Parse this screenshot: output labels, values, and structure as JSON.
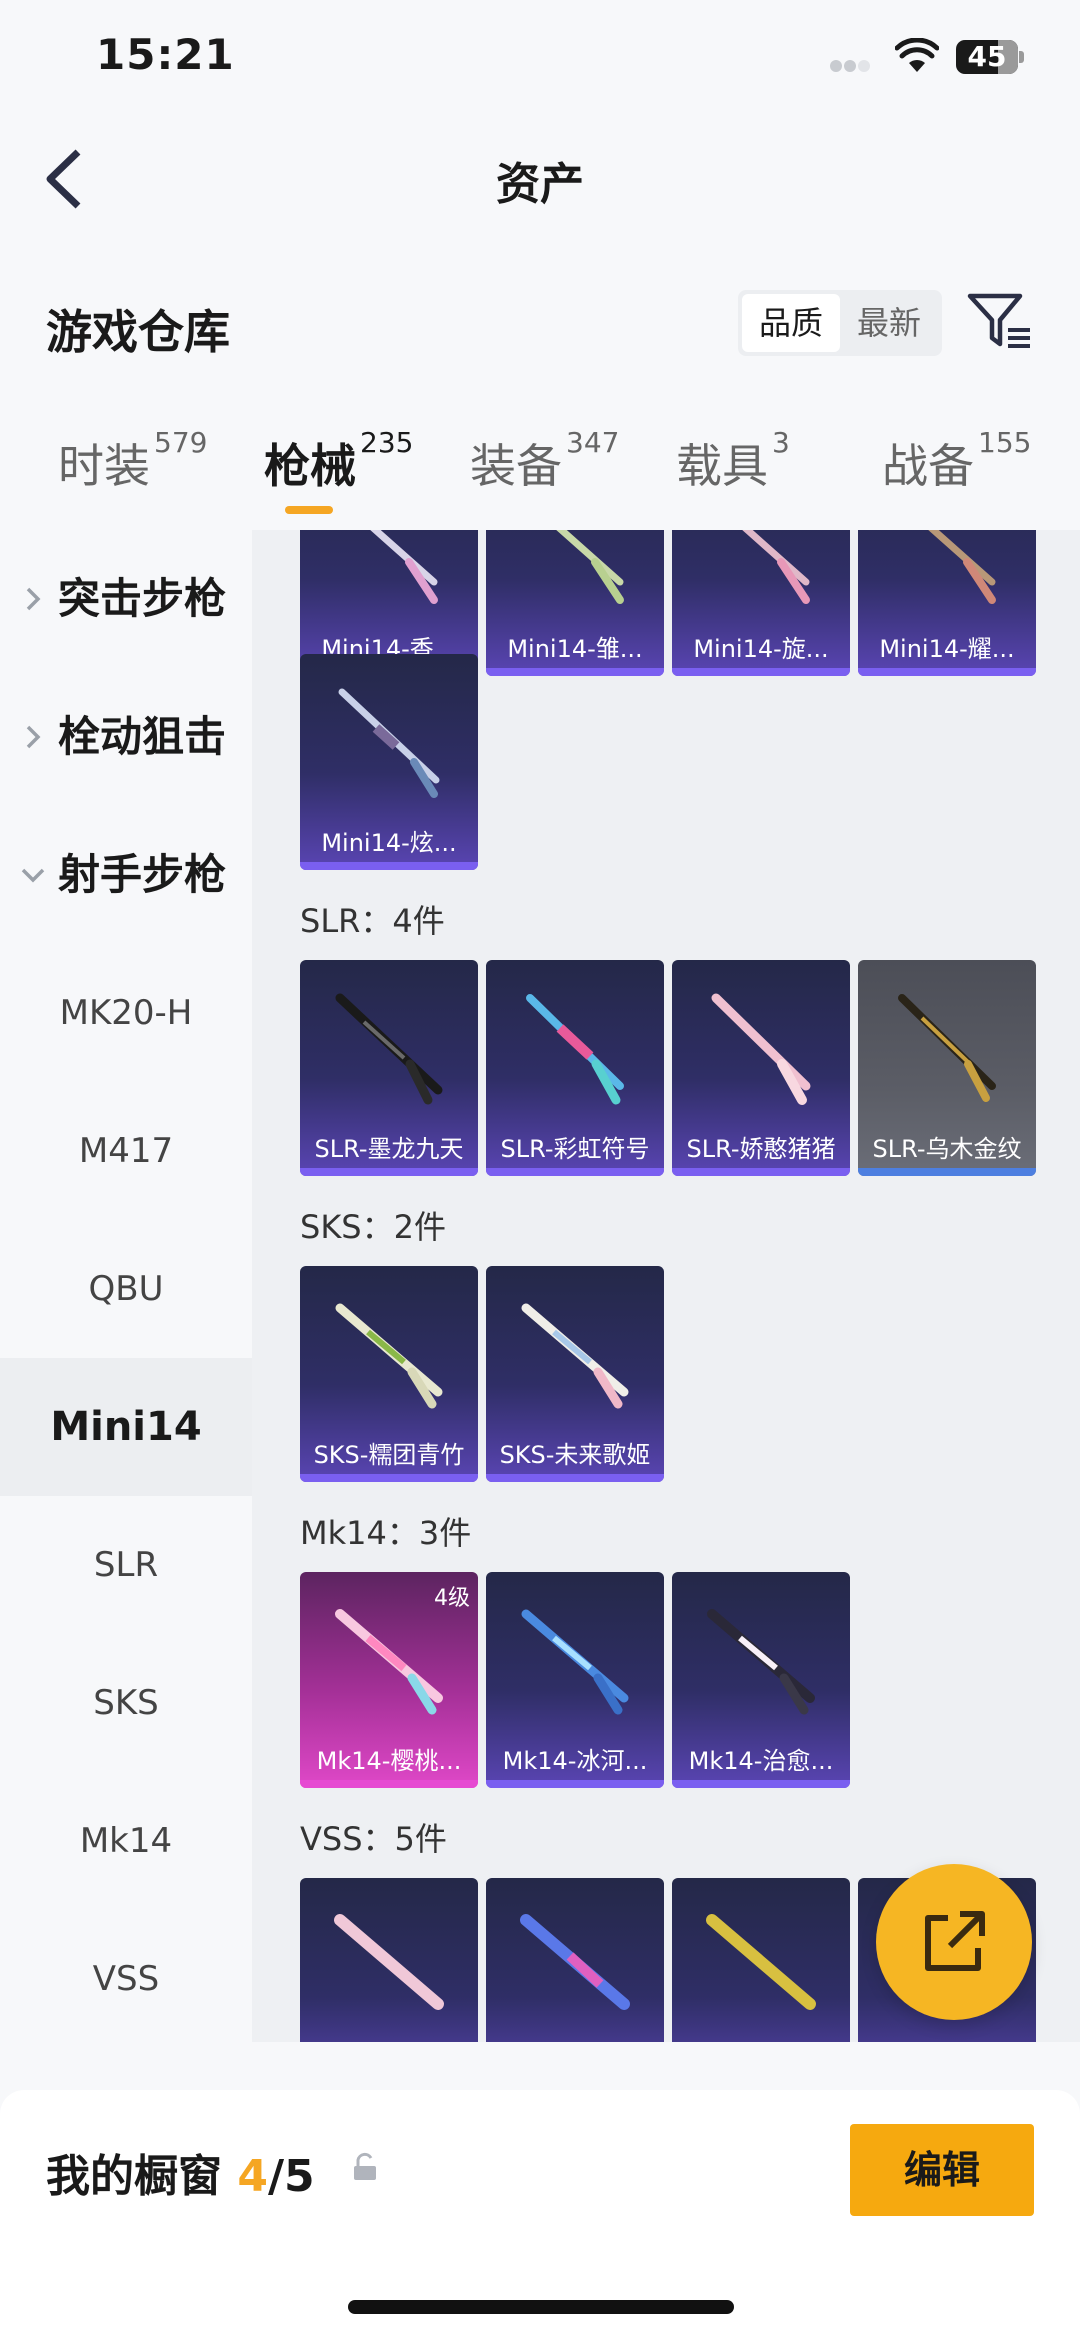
{
  "status": {
    "time": "15:21",
    "battery": "45"
  },
  "nav": {
    "title": "资产"
  },
  "header": {
    "title": "游戏仓库",
    "sort_active": "品质",
    "sort_other": "最新"
  },
  "tabs": [
    {
      "label": "时装",
      "count": "579"
    },
    {
      "label": "枪械",
      "count": "235"
    },
    {
      "label": "装备",
      "count": "347"
    },
    {
      "label": "载具",
      "count": "3"
    },
    {
      "label": "战备",
      "count": "155"
    }
  ],
  "sidebar": {
    "categories": [
      "突击步枪",
      "栓动狙击",
      "射手步枪"
    ],
    "subs": [
      "MK20-H",
      "M417",
      "QBU",
      "Mini14",
      "SLR",
      "SKS",
      "Mk14",
      "VSS"
    ]
  },
  "groups": {
    "mini14": {
      "cards": [
        "Mini14-香...",
        "Mini14-雏...",
        "Mini14-旋...",
        "Mini14-耀...",
        "Mini14-炫..."
      ]
    },
    "slr": {
      "label": "SLR：4件",
      "cards": [
        "SLR-墨龙九天",
        "SLR-彩虹符号",
        "SLR-娇憨猪猪",
        "SLR-乌木金纹"
      ]
    },
    "sks": {
      "label": "SKS：2件",
      "cards": [
        "SKS-糯团青竹",
        "SKS-未来歌姬"
      ]
    },
    "mk14": {
      "label": "Mk14：3件",
      "level": "4级",
      "cards": [
        "Mk14-樱桃...",
        "Mk14-冰河...",
        "Mk14-治愈..."
      ]
    },
    "vss": {
      "label": "VSS：5件"
    }
  },
  "bottom": {
    "label": "我的橱窗",
    "current": "4",
    "total": "/5",
    "edit": "编辑"
  },
  "colors": {
    "accent": "#f6a90f",
    "card_purple": "#5a45b4",
    "card_pink": "#e048c8"
  }
}
